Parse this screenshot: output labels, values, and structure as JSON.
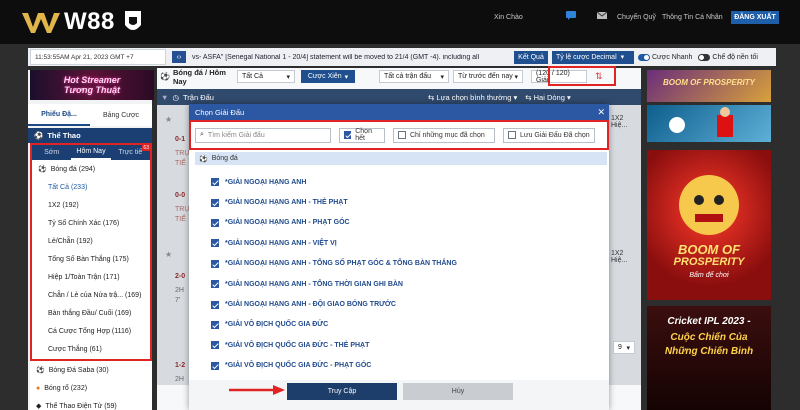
{
  "brand": {
    "name": "W88"
  },
  "topnav": {
    "greeting": "Xin Chào",
    "transfer": "Chuyển Quỹ",
    "profile": "Thông Tin Cá Nhân",
    "logout": "ĐĂNG XUẤT"
  },
  "infobar": {
    "clock": "11:53:55AM Apr 21, 2023 GMT +7",
    "ticker": "vs- ASFA\" [Senegal National 1 - 20/4] statement will be moved to 21/4 (GMT -4). including all",
    "results": "Kết Quả",
    "odds_type": "Tỷ lệ cược Decimal",
    "quick_bet": "Cược Nhanh",
    "dark_mode": "Chế độ nền tối"
  },
  "left": {
    "promo_line1": "Hot Streamer",
    "promo_line2": "Tương Thuật",
    "tab_slips": "Phiếu Đặ...",
    "tab_history": "Bảng Cược",
    "sports_header": "Thể Thao",
    "sport_tabs": [
      {
        "label": "Sớm"
      },
      {
        "label": "Hôm Nay"
      },
      {
        "label": "Trực tiế",
        "badge": "63"
      }
    ],
    "items": [
      {
        "label": "Bóng đá (294)"
      },
      {
        "label": "Tất Cả (233)"
      },
      {
        "label": "1X2 (192)"
      },
      {
        "label": "Tỷ Số Chính Xác (176)"
      },
      {
        "label": "Lẻ/Chẵn (192)"
      },
      {
        "label": "Tổng Số Bàn Thắng (175)"
      },
      {
        "label": "Hiệp 1/Toàn Trận (171)"
      },
      {
        "label": "Chẵn / Lẻ của Nửa trậ...  (169)"
      },
      {
        "label": "Bàn thắng Đầu/ Cuối (169)"
      },
      {
        "label": "Cá Cược Tổng Hợp (1116)"
      },
      {
        "label": "Cược Thắng (61)"
      }
    ],
    "extra": [
      "Bóng Đá Saba (30)",
      "Bóng rổ (232)",
      "Thể Thao Điện Tử (59)"
    ]
  },
  "center": {
    "sport_title": "Bóng đá / Hôm Nay",
    "filter_all": "Tất Cả",
    "parlay": "Cược Xiên",
    "all_matches": "Tất cả trận đấu",
    "sort": "Từ trước đến nay",
    "league_count": "(120 / 120) Giải",
    "match_header": "Trận Đấu",
    "select_normal": "Lựa chọn bình thường",
    "two_lines": "Hai Dòng",
    "ghost_labels": [
      "0-1",
      "TRỰ",
      "TIẾ",
      "0-0",
      "TRỰ",
      "TIẾ",
      "2-0",
      "2H",
      "7'",
      "1-2",
      "2H"
    ],
    "ghost_right": [
      "1X2 Hiệ...",
      "1X2 Hiệ..."
    ],
    "page_num": "9"
  },
  "modal": {
    "title": "Chọn Giải Đấu",
    "search_placeholder": "Tìm kiếm Giải đấu",
    "select_all": "Chọn hết",
    "only_selected": "Chỉ những mục đã chọn",
    "save_selected": "Lưu Giải Đấu Đã chọn",
    "group": "Bóng đá",
    "leagues": [
      "*GIẢI NGOẠI HẠNG ANH",
      "*GIẢI NGOẠI HẠNG ANH - THẺ PHẠT",
      "*GIẢI NGOẠI HẠNG ANH - PHẠT GÓC",
      "*GIẢI NGOẠI HẠNG ANH - VIỆT VỊ",
      "*GIẢI NGOẠI HẠNG ANH - TỔNG SỐ PHẠT GÓC & TỔNG BÀN THẮNG",
      "*GIẢI NGOẠI HẠNG ANH - TỔNG THỜI GIAN GHI BÀN",
      "*GIẢI NGOẠI HẠNG ANH - ĐỘI GIAO BÓNG TRƯỚC",
      "*GIẢI VÔ ĐỊCH QUỐC GIA ĐỨC",
      "*GIẢI VÔ ĐỊCH QUỐC GIA ĐỨC - THẺ PHẠT",
      "*GIẢI VÔ ĐỊCH QUỐC GIA ĐỨC - PHẠT GÓC"
    ],
    "confirm": "Truy Cập",
    "cancel": "Hủy"
  },
  "ads": {
    "ad1": "BOOM OF PROSPERITY",
    "ad3_a": "BOOM OF",
    "ad3_b": "PROSPERITY",
    "ad3_c": "Bấm để chơi",
    "ad4_a": "Cricket IPL 2023 -",
    "ad4_b": "Cuộc Chiến Của",
    "ad4_c": "Những Chiến Binh"
  },
  "colors": {
    "accent": "#1d4a86",
    "highlight": "#e02424",
    "modal_header": "#2c57a3"
  }
}
